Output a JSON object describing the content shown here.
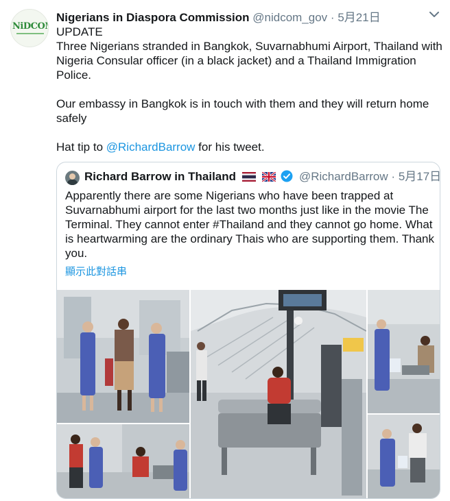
{
  "tweet": {
    "display_name": "Nigerians in Diaspora Commission",
    "handle": "@nidcom_gov",
    "separator": "·",
    "date": "5月21日",
    "avatar_logo_text": "NiDCOM",
    "body": {
      "line1": "UPDATE",
      "line2": "Three Nigerians stranded in Bangkok, Suvarnabhumi Airport, Thailand with Nigeria Consular officer (in a black jacket) and a Thailand Immigration Police.",
      "line3": "Our embassy in Bangkok is in touch with them and they will return home safely",
      "hat_tip_prefix": "Hat tip to ",
      "hat_tip_mention": "@RichardBarrow",
      "hat_tip_suffix": " for his tweet."
    }
  },
  "quoted": {
    "display_name": "Richard Barrow in Thailand",
    "handle": "@RichardBarrow",
    "separator": "·",
    "date": "5月17日",
    "text": "Apparently there are some Nigerians who have been trapped at Suvarnabhumi airport for the last two months just like in the movie The Terminal. They cannot enter #Thailand and they cannot go home.  What is heartwarming are the ordinary Thais who are supporting them. Thank you.",
    "show_thread": "顯示此對話串"
  },
  "icons": {
    "menu": "chevron-down-icon",
    "verified": "verified-badge-icon",
    "flag_thailand": "thailand-flag-icon",
    "flag_uk": "uk-flag-icon"
  },
  "colors": {
    "link": "#1b95e0",
    "secondary_text": "#657786",
    "verified": "#1da1f2",
    "border": "#ccd6dd",
    "logo_green": "#2e8b3a"
  }
}
